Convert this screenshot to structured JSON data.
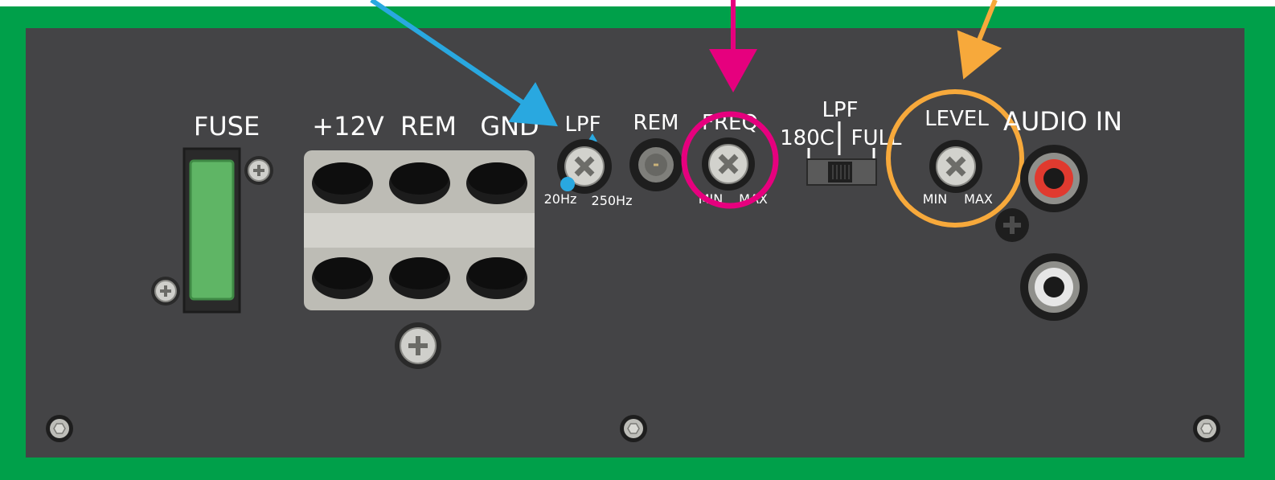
{
  "colors": {
    "border": "#00a04a",
    "panel": "#444446",
    "lpf_callout": "#29a8e0",
    "freq_callout": "#e6007e",
    "level_callout": "#f7a93b",
    "fuse": "#5fb565",
    "terminal_block": "#bdbcb5",
    "rca_red": "#e03a2f",
    "rca_white": "#e6e6e6"
  },
  "labels": {
    "fuse": "FUSE",
    "plus12v": "+12V",
    "rem_terminal": "REM",
    "gnd": "GND",
    "lpf_knob": "LPF",
    "rem_led": "REM",
    "freq": "FREQ",
    "lpf_switch": "LPF",
    "switch_left": "180C",
    "switch_right": "FULL",
    "level": "LEVEL",
    "audio_in": "AUDIO IN",
    "lpf_min": "20Hz",
    "lpf_max": "250Hz",
    "freq_min": "MIN",
    "freq_max": "MAX",
    "level_min": "MIN",
    "level_max": "MAX"
  },
  "icons": {
    "screw": "phillips-screw-icon",
    "knob": "cross-knob-icon",
    "hex_screw": "hex-screw-icon",
    "led": "led-indicator-icon",
    "arrow": "arrow-icon"
  }
}
